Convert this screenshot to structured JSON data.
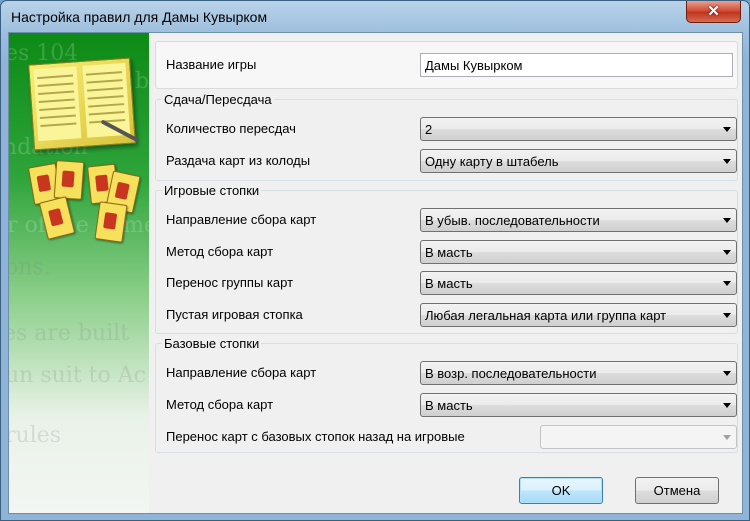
{
  "window": {
    "title": "Настройка правил для Дамы Кувырком",
    "close_symbol": "✕"
  },
  "side_image": {
    "watermark_lines": [
      "es 104",
      "ards b",
      "ndation",
      "r of the game",
      "ons.",
      "es are built",
      "un suit to Ac",
      "rules"
    ]
  },
  "game_name": {
    "label": "Название игры",
    "value": "Дамы Кувырком"
  },
  "deal_section": {
    "legend": "Сдача/Пересдача",
    "rows": [
      {
        "label": "Количество пересдач",
        "value": "2"
      },
      {
        "label": "Раздача карт из колоды",
        "value": "Одну карту в штабель"
      }
    ]
  },
  "tableau_section": {
    "legend": "Игровые стопки",
    "rows": [
      {
        "label": "Направление сбора карт",
        "value": "В убыв. последовательности"
      },
      {
        "label": "Метод сбора карт",
        "value": "В масть"
      },
      {
        "label": "Перенос группы карт",
        "value": "В масть"
      },
      {
        "label": "Пустая игровая стопка",
        "value": "Любая легальная карта или группа карт"
      }
    ]
  },
  "foundation_section": {
    "legend": "Базовые стопки",
    "rows": [
      {
        "label": "Направление сбора карт",
        "value": "В возр. последовательности"
      },
      {
        "label": "Метод сбора карт",
        "value": "В масть"
      },
      {
        "label": "Перенос карт с базовых стопок назад на игровые",
        "value": ""
      }
    ]
  },
  "buttons": {
    "ok": "OK",
    "cancel": "Отмена"
  },
  "colors": {
    "close_button": "#c0341e",
    "default_button_border": "#3c7fb1",
    "side_green": "#0d8a16"
  }
}
